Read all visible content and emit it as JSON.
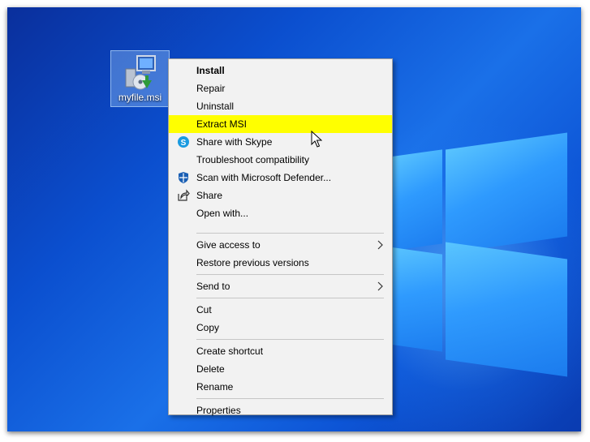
{
  "desktop": {
    "file_icon_label": "myfile.msi"
  },
  "context_menu": {
    "install": "Install",
    "repair": "Repair",
    "uninstall": "Uninstall",
    "extract_msi": "Extract MSI",
    "share_skype": "Share with Skype",
    "troubleshoot": "Troubleshoot compatibility",
    "scan_defender": "Scan with Microsoft Defender...",
    "share": "Share",
    "open_with": "Open with...",
    "give_access": "Give access to",
    "restore_versions": "Restore previous versions",
    "send_to": "Send to",
    "cut": "Cut",
    "copy": "Copy",
    "create_shortcut": "Create shortcut",
    "delete": "Delete",
    "rename": "Rename",
    "properties": "Properties"
  },
  "colors": {
    "highlight": "#ffff00",
    "menu_bg": "#f2f2f2",
    "desktop_blue": "#0b4fcf"
  }
}
